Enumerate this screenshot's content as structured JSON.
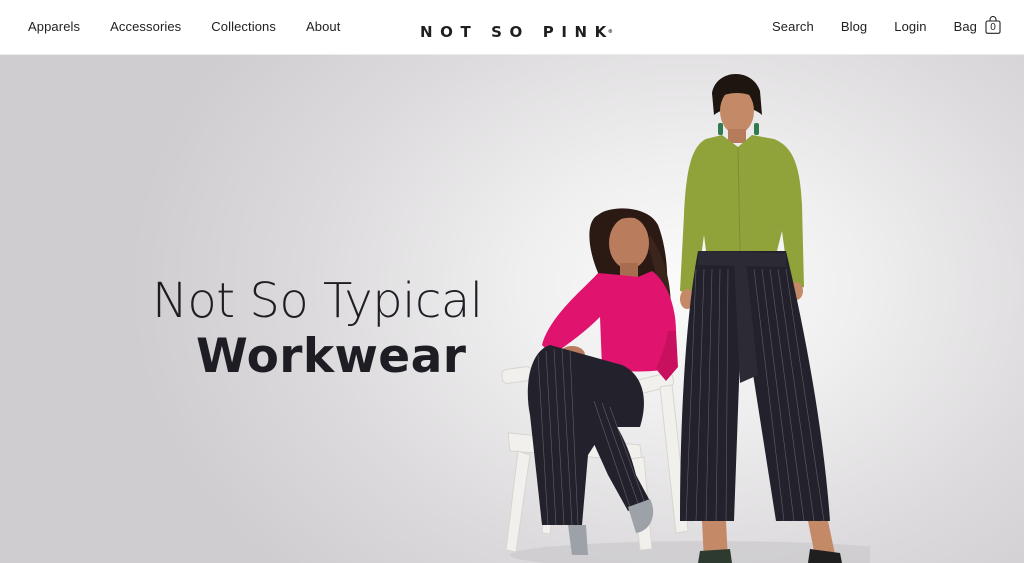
{
  "header": {
    "nav_left": [
      {
        "label": "Apparels"
      },
      {
        "label": "Accessories"
      },
      {
        "label": "Collections"
      },
      {
        "label": "About"
      }
    ],
    "logo": "NOT SO PINK",
    "logo_mark": "®",
    "nav_right": {
      "search": "Search",
      "blog": "Blog",
      "login": "Login",
      "bag": "Bag",
      "bag_count": "0"
    }
  },
  "hero": {
    "headline_line1": "Not So Typical",
    "headline_line2": "Workwear"
  },
  "colors": {
    "text": "#1f1d24",
    "pink_top": "#e0146e",
    "green_top": "#8fa33a",
    "trousers": "#23222c"
  }
}
